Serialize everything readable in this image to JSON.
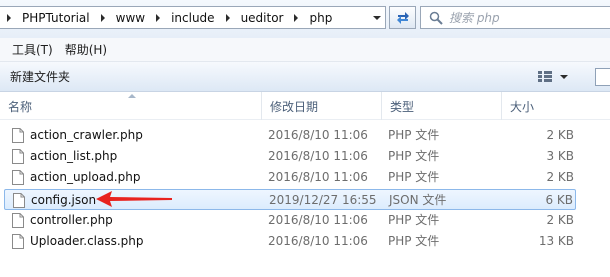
{
  "address": {
    "crumbs": [
      "PHPTutorial",
      "www",
      "include",
      "ueditor",
      "php"
    ]
  },
  "search": {
    "placeholder": "搜索 php"
  },
  "menu": {
    "items": [
      "工具(T)",
      "帮助(H)"
    ]
  },
  "toolbar": {
    "new_folder_label": "新建文件夹"
  },
  "columns": {
    "name": "名称",
    "modified": "修改日期",
    "type": "类型",
    "size": "大小"
  },
  "files": [
    {
      "name": "action_crawler.php",
      "modified": "2016/8/10 11:06",
      "type": "PHP 文件",
      "size": "2 KB",
      "selected": false
    },
    {
      "name": "action_list.php",
      "modified": "2016/8/10 11:06",
      "type": "PHP 文件",
      "size": "3 KB",
      "selected": false
    },
    {
      "name": "action_upload.php",
      "modified": "2016/8/10 11:06",
      "type": "PHP 文件",
      "size": "2 KB",
      "selected": false
    },
    {
      "name": "config.json",
      "modified": "2019/12/27 16:55",
      "type": "JSON 文件",
      "size": "6 KB",
      "selected": true
    },
    {
      "name": "controller.php",
      "modified": "2016/8/10 11:06",
      "type": "PHP 文件",
      "size": "2 KB",
      "selected": false
    },
    {
      "name": "Uploader.class.php",
      "modified": "2016/8/10 11:06",
      "type": "PHP 文件",
      "size": "13 KB",
      "selected": false
    }
  ],
  "annotation": {
    "arrow_color": "#e8231f"
  },
  "icons": {
    "refresh": "refresh-icon",
    "search": "search-icon",
    "view": "view-options-icon",
    "file": "file-icon"
  }
}
